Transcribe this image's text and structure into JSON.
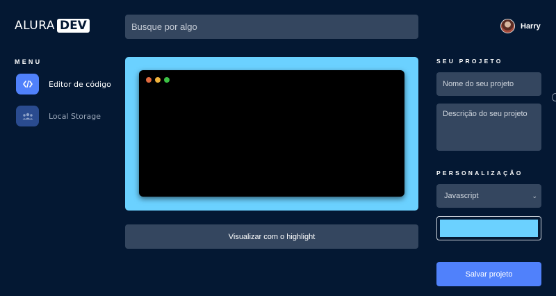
{
  "header": {
    "logo_part1": "ALURA",
    "logo_part2": "DEV",
    "search_placeholder": "Busque por algo",
    "user_name": "Harry"
  },
  "menu": {
    "title": "MENU",
    "items": [
      {
        "label": "Editor de código",
        "icon": "code-icon",
        "active": true
      },
      {
        "label": "Local Storage",
        "icon": "users-icon",
        "active": false
      }
    ]
  },
  "editor": {
    "frame_color": "#6bd1ff",
    "window_dots": [
      "#e06a3f",
      "#f0b33c",
      "#3cc145"
    ],
    "preview_button_label": "Visualizar com o highlight"
  },
  "project": {
    "section_title": "SEU PROJETO",
    "name_placeholder": "Nome do seu projeto",
    "description_placeholder": "Descrição do seu projeto"
  },
  "customization": {
    "section_title": "PERSONALIZAÇÃO",
    "language_selected": "Javascript",
    "color_value": "#6bd1ff",
    "save_button_label": "Salvar projeto"
  },
  "colors": {
    "background": "#041833",
    "field": "#34465f",
    "accent": "#5081fb"
  }
}
